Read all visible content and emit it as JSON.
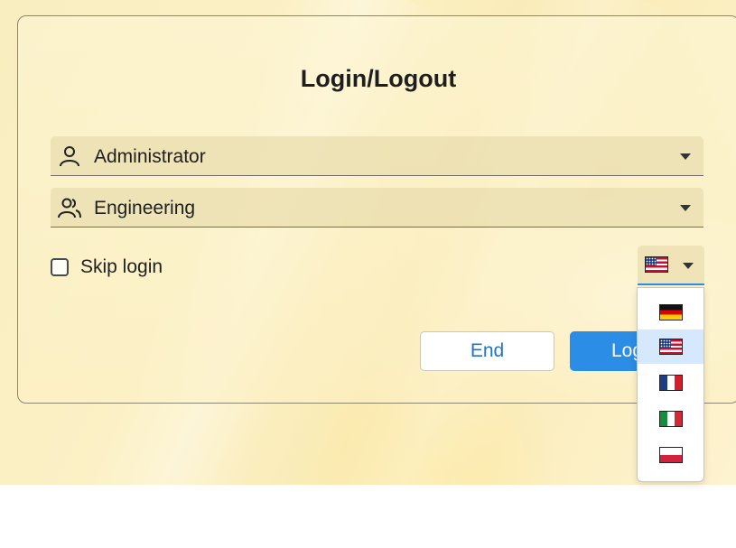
{
  "dialog": {
    "title": "Login/Logout",
    "user": {
      "value": "Administrator",
      "icon": "user-icon"
    },
    "group": {
      "value": "Engineering",
      "icon": "users-icon"
    },
    "skip_login": {
      "label": "Skip login",
      "checked": false
    },
    "language": {
      "selected": "US",
      "options": [
        {
          "code": "DE",
          "icon": "flag-germany-icon"
        },
        {
          "code": "US",
          "icon": "flag-usa-icon"
        },
        {
          "code": "FR",
          "icon": "flag-france-icon"
        },
        {
          "code": "IT",
          "icon": "flag-italy-icon"
        },
        {
          "code": "PL",
          "icon": "flag-poland-icon"
        }
      ]
    },
    "buttons": {
      "end": "End",
      "login": "Login"
    }
  },
  "colors": {
    "accent": "#2b8de6",
    "panel": "#fcf1c6",
    "field": "#e9ddaf"
  }
}
